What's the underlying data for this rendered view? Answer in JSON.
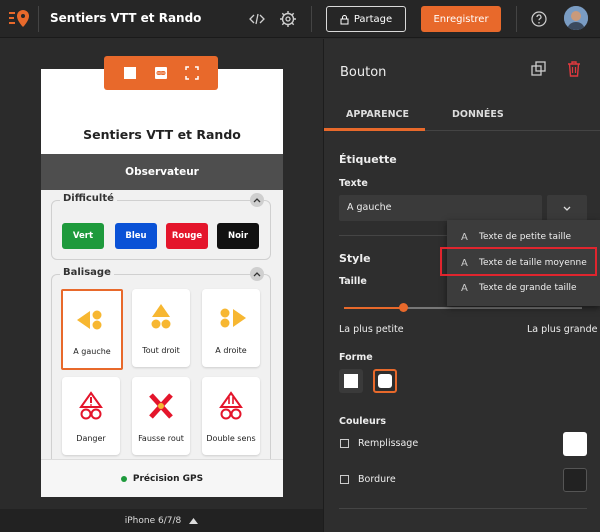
{
  "app": {
    "title": "Sentiers VTT et Rando",
    "share_label": "Partage",
    "save_label": "Enregistrer"
  },
  "icons": {
    "logo": "logo-icon",
    "code": "code-icon",
    "settings": "gear-icon",
    "help": "help-icon",
    "lock": "lock-icon"
  },
  "colors": {
    "accent": "#e8692b",
    "highlight": "#e0252e",
    "green": "#1e9a3c",
    "blue": "#0a52d6",
    "red": "#e4152b",
    "black": "#111111",
    "sign_yellow": "#f7b731",
    "sign_red": "#e4152b"
  },
  "preview": {
    "title": "Sentiers VTT et Rando",
    "observer": "Observateur",
    "difficulty": {
      "title": "Difficulté",
      "buttons": [
        "Vert",
        "Bleu",
        "Rouge",
        "Noir"
      ]
    },
    "markings": {
      "title": "Balisage",
      "items": [
        "A gauche",
        "Tout droit",
        "A droite",
        "Danger",
        "Fausse rout",
        "Double sens"
      ]
    },
    "gps": "Précision GPS",
    "device": "iPhone 6/7/8"
  },
  "panel": {
    "title": "Bouton",
    "tabs": [
      "APPARENCE",
      "DONNÉES"
    ],
    "label_section": "Étiquette",
    "text_label": "Texte",
    "text_value": "A gauche",
    "style_section": "Style",
    "size_label": "Taille",
    "size_min": "La plus petite",
    "size_max": "La plus grande",
    "size_level_percent": 25,
    "shape_label": "Forme",
    "colors_label": "Couleurs",
    "fill_label": "Remplissage",
    "border_label": "Bordure"
  },
  "dropdown": {
    "items": [
      "Texte de petite taille",
      "Texte de taille moyenne",
      "Texte de grande taille"
    ],
    "highlighted_index": 1
  }
}
